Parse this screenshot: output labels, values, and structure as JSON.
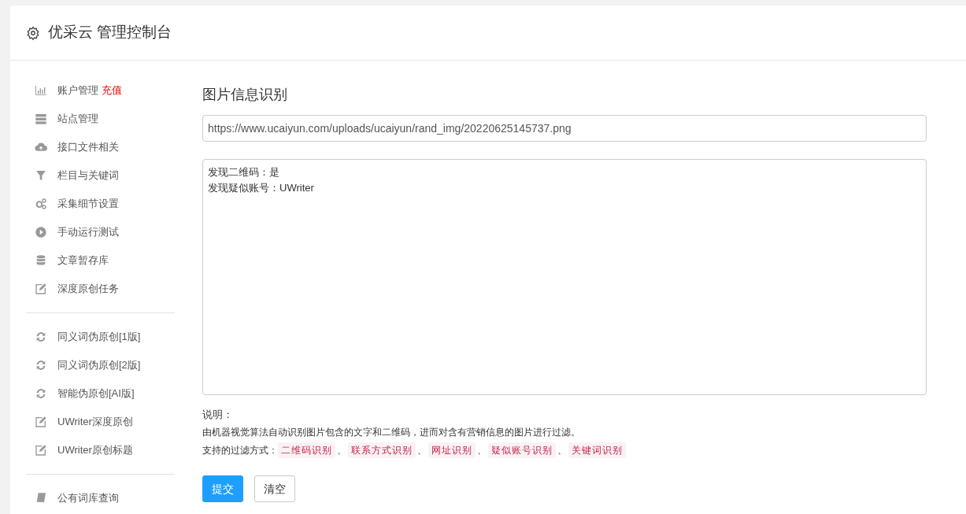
{
  "header": {
    "title": "优采云 管理控制台"
  },
  "sidebar": {
    "sections": [
      {
        "items": [
          {
            "label": "账户管理",
            "link": "充值"
          },
          {
            "label": "站点管理"
          },
          {
            "label": "接口文件相关"
          },
          {
            "label": "栏目与关键词"
          },
          {
            "label": "采集细节设置"
          },
          {
            "label": "手动运行测试"
          },
          {
            "label": "文章暂存库"
          },
          {
            "label": "深度原创任务"
          }
        ]
      },
      {
        "items": [
          {
            "label": "同义词伪原创[1版]"
          },
          {
            "label": "同义词伪原创[2版]"
          },
          {
            "label": "智能伪原创[AI版]"
          },
          {
            "label": "UWriter深度原创"
          },
          {
            "label": "UWriter原创标题"
          }
        ]
      },
      {
        "items": [
          {
            "label": "公有词库查询"
          }
        ]
      }
    ]
  },
  "main": {
    "title": "图片信息识别",
    "url_field": {
      "value": "https://www.ucaiyun.com/uploads/ucaiyun/rand_img/20220625145737.png"
    },
    "result_box": {
      "lines": [
        "发现二维码：是",
        "发现疑似账号：UWriter"
      ]
    },
    "notes": {
      "heading": "说明：",
      "description": "由机器视觉算法自动识别图片包含的文字和二维码，进而对含有营销信息的图片进行过滤。",
      "methods_label": "支持的过滤方式：",
      "methods": [
        "二维码识别",
        "联系方式识别",
        "网址识别",
        "疑似账号识别",
        "关键词识别"
      ],
      "separator": "、"
    },
    "buttons": [
      {
        "label": "提交",
        "kind": "primary"
      },
      {
        "label": "清空",
        "kind": "default"
      }
    ]
  }
}
